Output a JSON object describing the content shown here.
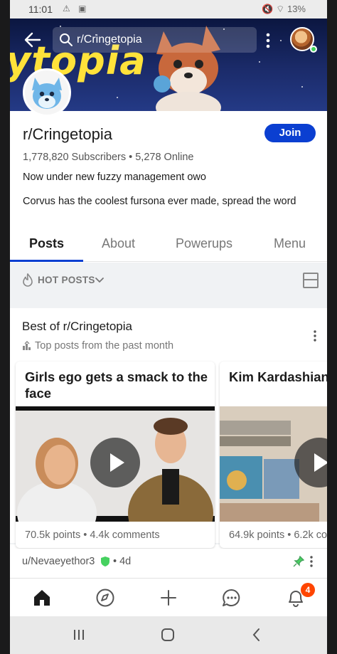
{
  "status_bar": {
    "time": "11:01",
    "battery": "13%"
  },
  "header": {
    "search_text": "r/Cringetopia",
    "banner_text": "ytopia"
  },
  "subreddit": {
    "name": "r/Cringetopia",
    "join_label": "Join",
    "stats": "1,778,820 Subscribers • 5,278 Online",
    "description_1": "Now under new fuzzy management owo",
    "description_2": "Corvus has the coolest fursona ever made, spread the word"
  },
  "tabs": [
    {
      "label": "Posts",
      "active": true
    },
    {
      "label": "About",
      "active": false
    },
    {
      "label": "Powerups",
      "active": false
    },
    {
      "label": "Menu",
      "active": false
    }
  ],
  "sort": {
    "label": "HOT POSTS"
  },
  "best_of": {
    "title": "Best of r/Cringetopia",
    "subtitle": "Top posts from the past month",
    "cards": [
      {
        "title": "Girls ego gets a smack to the face",
        "meta": "70.5k points • 4.4k comments"
      },
      {
        "title": "Kim Kardashian's son sees pop-up",
        "meta": "64.9k points • 6.2k co"
      }
    ]
  },
  "next_post": {
    "author": "u/Nevaeyethor3",
    "age": "• 4d"
  },
  "bottom_nav": {
    "notification_count": "4"
  },
  "colors": {
    "accent": "#0b3fd1",
    "banner_text": "#ffe23a",
    "badge": "#ff4500"
  },
  "icons": [
    "back-arrow-icon",
    "search-icon",
    "kebab-menu-icon",
    "flame-icon",
    "chevron-down-icon",
    "card-layout-icon",
    "home-icon",
    "compass-icon",
    "plus-icon",
    "chat-icon",
    "bell-icon"
  ]
}
